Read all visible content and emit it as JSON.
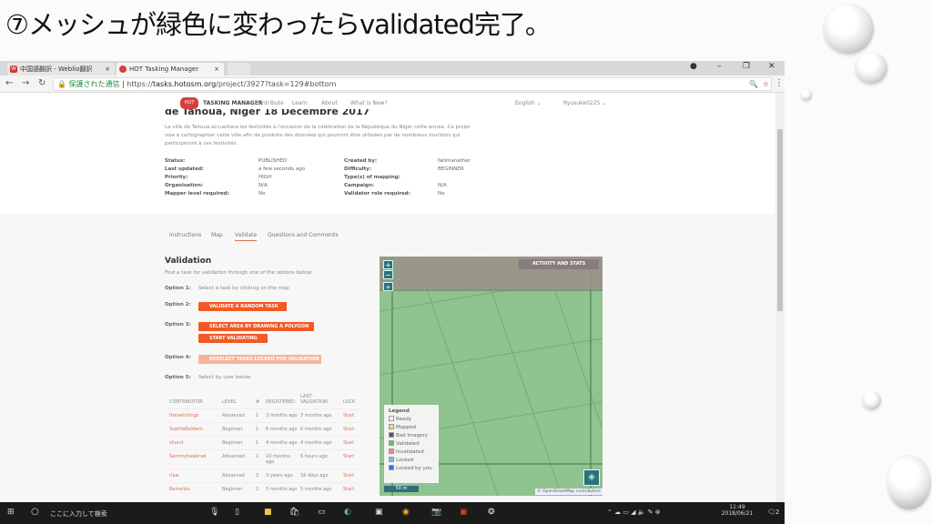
{
  "slide": {
    "title": "⑦メッシュが緑色に変わったらvalidated完了。"
  },
  "browser": {
    "tabs": [
      {
        "label": "中国語翻訳 - Weblio翻訳",
        "icon": "weblio-icon"
      },
      {
        "label": "HOT Tasking Manager",
        "icon": "hot-icon"
      }
    ],
    "secure_label": "保護された通信",
    "url_prefix": "https://",
    "url_host": "tasks.hotosm.org",
    "url_path": "/project/3927?task=129#bottom"
  },
  "header": {
    "logo_text": "HOT",
    "brand": "TASKING MANAGER",
    "nav": [
      "Contribute",
      "Learn",
      "About",
      "What is New?"
    ],
    "language": "English",
    "user": "Ryusuke0225"
  },
  "project": {
    "title": "de Tahoua, Niger 18 Décembre 2017",
    "description": "La ville de Tahoua accueillera les festivités à l'occasion de la célébration de la République du Niger cette année. Ce projet vise à cartographier cette ville afin de produire des données qui pourront être utilisées par de nombreux touristes qui participeront à ces festivités.",
    "meta_left": [
      [
        "Status:",
        "PUBLISHED"
      ],
      [
        "Last updated:",
        "a few seconds ago"
      ],
      [
        "Priority:",
        "HIGH"
      ],
      [
        "Organisation:",
        "N/A"
      ],
      [
        "Mapper level required:",
        "No"
      ]
    ],
    "meta_right": [
      [
        "Created by:",
        "fatimanather"
      ],
      [
        "Difficulty:",
        "BEGINNER"
      ],
      [
        "Type(s) of mapping:",
        ""
      ],
      [
        "Campaign:",
        "N/A"
      ],
      [
        "Validator role required:",
        "No"
      ]
    ]
  },
  "tabs": [
    "Instructions",
    "Map",
    "Validate",
    "Questions and Comments"
  ],
  "validation": {
    "title": "Validation",
    "intro": "Find a task for validation through one of the options below.",
    "option1": "Option 1:",
    "option1_text": "Select a task by clicking on the map",
    "option2": "Option 2:",
    "validate_random": "VALIDATE A RANDOM TASK",
    "option3": "Option 3:",
    "select_polygon": "SELECT AREA BY DRAWING A POLYGON",
    "start_validating": "START VALIDATING",
    "option4": "Option 4:",
    "reselect": "RESELECT TASKS LOCKED FOR VALIDATION",
    "option5": "Option 5:",
    "option5_text": "Select by user below"
  },
  "table": {
    "headers": [
      "CONTRIBUTOR",
      "LEVEL",
      "#",
      "REGISTERED",
      "LAST VALIDATION",
      "LOCK"
    ],
    "rows": [
      [
        "thevetchings",
        "Advanced",
        "1",
        "3 months ago",
        "3 months ago",
        "Start"
      ],
      [
        "SophieBaldwin",
        "Beginner",
        "1",
        "6 months ago",
        "6 months ago",
        "Start"
      ],
      [
        "shurst",
        "Beginner",
        "1",
        "4 months ago",
        "4 months ago",
        "Start"
      ],
      [
        "Sammyhawkrad",
        "Advanced",
        "1",
        "10 months ago",
        "6 hours ago",
        "Start"
      ],
      [
        "rlaw",
        "Advanced",
        "3",
        "3 years ago",
        "16 days ago",
        "Start"
      ],
      [
        "Remelios",
        "Beginner",
        "2",
        "5 months ago",
        "5 months ago",
        "Start"
      ]
    ]
  },
  "map": {
    "activity": "ACTIVITY AND STATS",
    "zoom_in": "+",
    "zoom_out": "−",
    "expand": "»",
    "scale": "50 m",
    "attribution": "© OpenStreetMap contributors",
    "legend_title": "Legend",
    "legend": [
      {
        "label": "Ready",
        "color": "#f4f4f4"
      },
      {
        "label": "Mapped",
        "color": "#f5d97a"
      },
      {
        "label": "Bad imagery",
        "color": "#555555"
      },
      {
        "label": "Validated",
        "color": "#6fbf6f"
      },
      {
        "label": "Invalidated",
        "color": "#f08a9a"
      },
      {
        "label": "Locked",
        "color": "#8fb0e8"
      },
      {
        "label": "Locked by you",
        "color": "#3b6de0"
      }
    ]
  },
  "taskbar": {
    "search_placeholder": "ここに入力して検索",
    "time": "11:49",
    "date": "2018/06/21",
    "notifications": "2"
  }
}
